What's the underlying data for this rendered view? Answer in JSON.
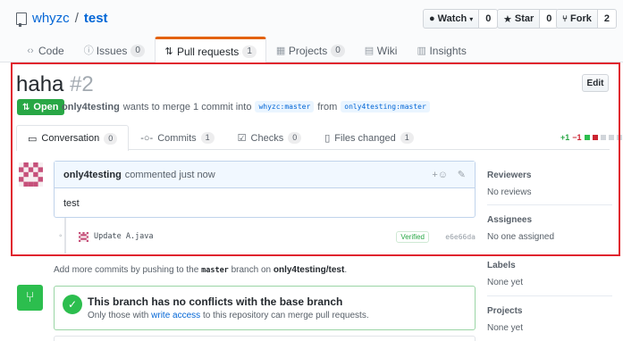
{
  "repo": {
    "owner": "whyzc",
    "separator": "/",
    "name": "test",
    "watch_label": "Watch",
    "watch_count": "0",
    "star_label": "Star",
    "star_count": "0",
    "fork_label": "Fork",
    "fork_count": "2"
  },
  "repo_tabs": [
    {
      "label": "Code",
      "icon": "<>",
      "count": ""
    },
    {
      "label": "Issues",
      "icon": "!",
      "count": "0"
    },
    {
      "label": "Pull requests",
      "icon": "pr",
      "count": "1"
    },
    {
      "label": "Projects",
      "icon": "proj",
      "count": "0"
    },
    {
      "label": "Wiki",
      "icon": "wiki",
      "count": ""
    },
    {
      "label": "Insights",
      "icon": "graph",
      "count": ""
    }
  ],
  "pr": {
    "title": "haha",
    "number": "#2",
    "edit_label": "Edit",
    "state": "Open",
    "author": "only4testing",
    "meta_text": "wants to merge 1 commit into",
    "base_branch": "whyzc:master",
    "from_text": "from",
    "head_branch": "only4testing:master"
  },
  "pr_tabs": [
    {
      "label": "Conversation",
      "count": "0"
    },
    {
      "label": "Commits",
      "count": "1"
    },
    {
      "label": "Checks",
      "count": "0"
    },
    {
      "label": "Files changed",
      "count": "1"
    }
  ],
  "diffstat": {
    "additions": "+1",
    "deletions": "−1"
  },
  "comment": {
    "author": "only4testing",
    "action": "commented just now",
    "body": "test"
  },
  "commit": {
    "message": "Update A.java",
    "verified_label": "Verified",
    "sha": "e6e66da"
  },
  "sidebar": {
    "reviewers_label": "Reviewers",
    "reviewers_value": "No reviews",
    "assignees_label": "Assignees",
    "assignees_value": "No one assigned",
    "labels_label": "Labels",
    "labels_value": "None yet",
    "projects_label": "Projects",
    "projects_value": "None yet"
  },
  "add_commits": {
    "prefix": "Add more commits by pushing to the",
    "branch": "master",
    "middle": "branch on",
    "repo": "only4testing/test",
    "suffix": "."
  },
  "merge": {
    "title": "This branch has no conflicts with the base branch",
    "sub_prefix": "Only those with",
    "sub_link": "write access",
    "sub_suffix": "to this repository can merge pull requests."
  },
  "colors": {
    "open_green": "#28a745",
    "highlight_red": "#e0242e",
    "tab_accent": "#e36209"
  }
}
